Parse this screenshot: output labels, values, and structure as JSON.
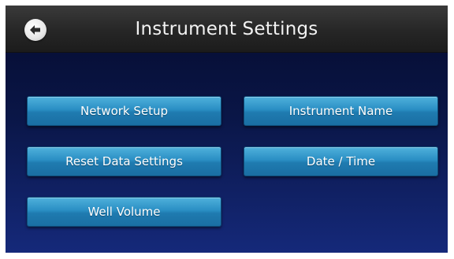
{
  "header": {
    "title": "Instrument Settings",
    "back_icon": "back-arrow-icon"
  },
  "buttons": {
    "network_setup": "Network Setup",
    "instrument_name": "Instrument Name",
    "reset_data_settings": "Reset Data Settings",
    "date_time": "Date / Time",
    "well_volume": "Well Volume"
  },
  "colors": {
    "header_bg": "#262626",
    "screen_bg_top": "#050b2e",
    "screen_bg_bottom": "#15297a",
    "button_bg": "#2a8fc4",
    "button_text": "#ffffff",
    "title_text": "#f2f2f2"
  }
}
